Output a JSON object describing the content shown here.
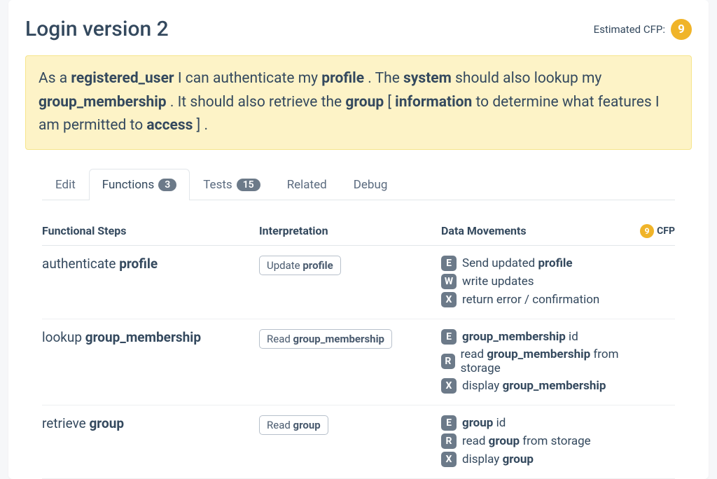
{
  "header": {
    "title": "Login version 2",
    "estimated_label": "Estimated CFP:",
    "estimated_value": "9"
  },
  "story": {
    "parts": [
      {
        "t": "As a ",
        "b": false
      },
      {
        "t": "registered_user",
        "b": true
      },
      {
        "t": " I can authenticate my ",
        "b": false
      },
      {
        "t": "profile",
        "b": true
      },
      {
        "t": " . The ",
        "b": false
      },
      {
        "t": "system",
        "b": true
      },
      {
        "t": " should also lookup my ",
        "b": false
      },
      {
        "t": "group_membership",
        "b": true
      },
      {
        "t": " . It should also retrieve the ",
        "b": false
      },
      {
        "t": "group",
        "b": true
      },
      {
        "t": " [ ",
        "b": false
      },
      {
        "t": "information",
        "b": true
      },
      {
        "t": " to determine what features I am permitted to ",
        "b": false
      },
      {
        "t": "access",
        "b": true
      },
      {
        "t": " ] .",
        "b": false
      }
    ]
  },
  "tabs": [
    {
      "label": "Edit",
      "count": null,
      "active": false
    },
    {
      "label": "Functions",
      "count": "3",
      "active": true
    },
    {
      "label": "Tests",
      "count": "15",
      "active": false
    },
    {
      "label": "Related",
      "count": null,
      "active": false
    },
    {
      "label": "Debug",
      "count": null,
      "active": false
    }
  ],
  "table": {
    "headers": {
      "step": "Functional Steps",
      "interp": "Interpretation",
      "dm": "Data Movements",
      "cfp_label": "CFP",
      "cfp_value": "9"
    },
    "rows": [
      {
        "step": [
          {
            "t": "authenticate ",
            "b": false
          },
          {
            "t": "profile",
            "b": true
          }
        ],
        "interp": [
          {
            "t": "Update ",
            "b": false
          },
          {
            "t": "profile",
            "b": true
          }
        ],
        "movements": [
          {
            "code": "E",
            "parts": [
              {
                "t": "Send updated ",
                "b": false
              },
              {
                "t": "profile",
                "b": true
              }
            ]
          },
          {
            "code": "W",
            "parts": [
              {
                "t": "write updates",
                "b": false
              }
            ]
          },
          {
            "code": "X",
            "parts": [
              {
                "t": "return error / confirmation",
                "b": false
              }
            ]
          }
        ]
      },
      {
        "step": [
          {
            "t": "lookup ",
            "b": false
          },
          {
            "t": "group_membership",
            "b": true
          }
        ],
        "interp": [
          {
            "t": "Read ",
            "b": false
          },
          {
            "t": "group_membership",
            "b": true
          }
        ],
        "movements": [
          {
            "code": "E",
            "parts": [
              {
                "t": "group_membership",
                "b": true
              },
              {
                "t": " id",
                "b": false
              }
            ]
          },
          {
            "code": "R",
            "parts": [
              {
                "t": "read ",
                "b": false
              },
              {
                "t": "group_membership",
                "b": true
              },
              {
                "t": " from storage",
                "b": false
              }
            ]
          },
          {
            "code": "X",
            "parts": [
              {
                "t": "display ",
                "b": false
              },
              {
                "t": "group_membership",
                "b": true
              }
            ]
          }
        ]
      },
      {
        "step": [
          {
            "t": "retrieve ",
            "b": false
          },
          {
            "t": "group",
            "b": true
          }
        ],
        "interp": [
          {
            "t": "Read ",
            "b": false
          },
          {
            "t": "group",
            "b": true
          }
        ],
        "movements": [
          {
            "code": "E",
            "parts": [
              {
                "t": "group",
                "b": true
              },
              {
                "t": " id",
                "b": false
              }
            ]
          },
          {
            "code": "R",
            "parts": [
              {
                "t": "read ",
                "b": false
              },
              {
                "t": "group",
                "b": true
              },
              {
                "t": " from storage",
                "b": false
              }
            ]
          },
          {
            "code": "X",
            "parts": [
              {
                "t": "display ",
                "b": false
              },
              {
                "t": "group",
                "b": true
              }
            ]
          }
        ]
      }
    ]
  }
}
